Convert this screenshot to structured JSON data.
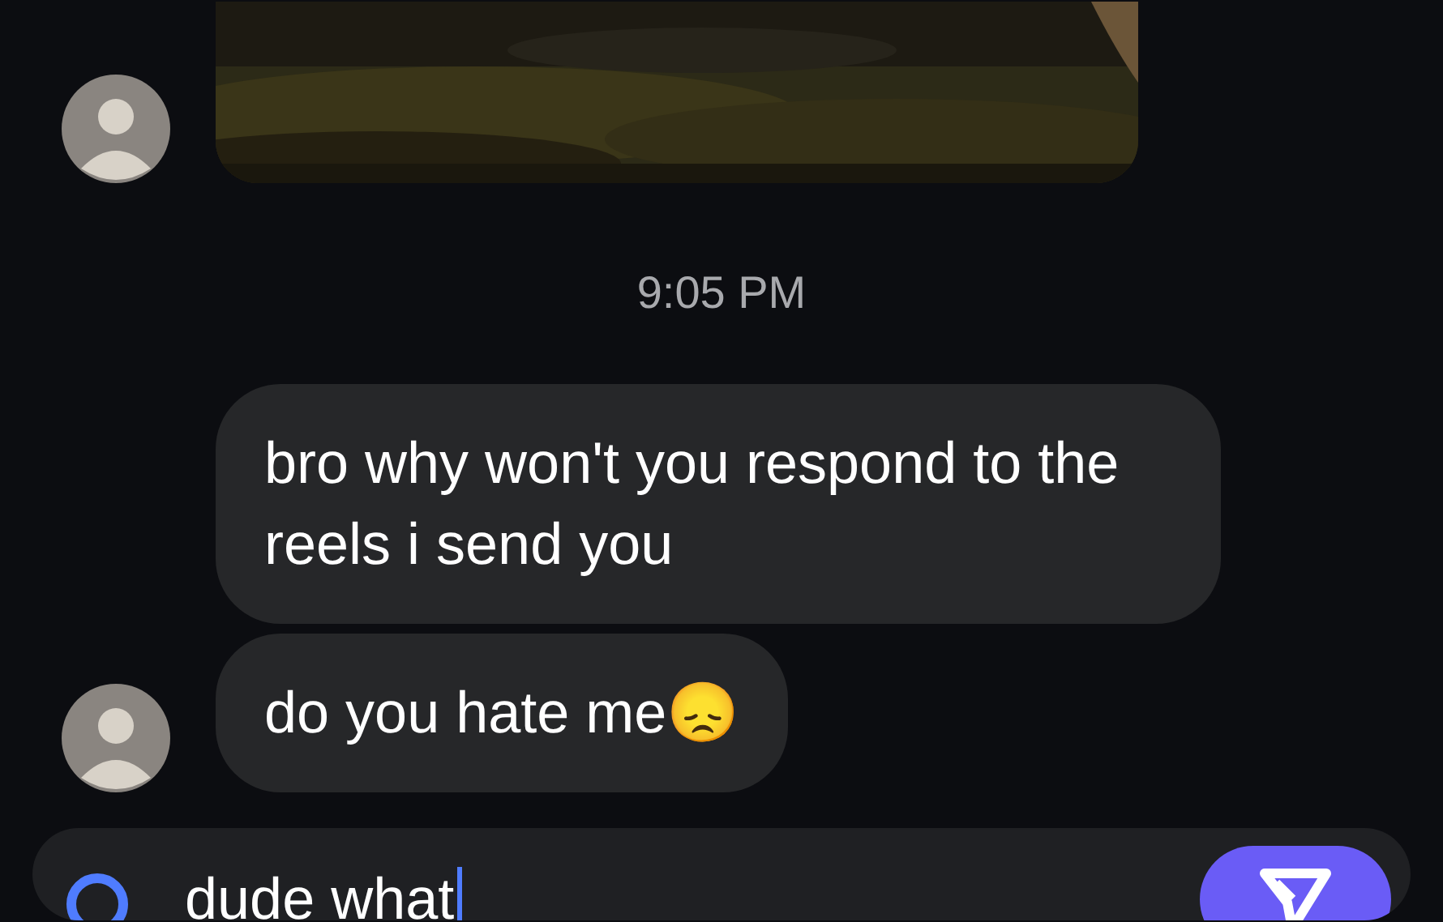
{
  "messages": [
    {
      "kind": "picture",
      "avatar": true
    },
    {
      "kind": "timestamp",
      "text": "9:05 PM"
    },
    {
      "kind": "text",
      "text": "bro why won't you respond to the reels i send you",
      "avatar": false
    },
    {
      "kind": "text",
      "text": "do you hate me😞",
      "avatar": true
    }
  ],
  "composer": {
    "value": "dude what"
  }
}
